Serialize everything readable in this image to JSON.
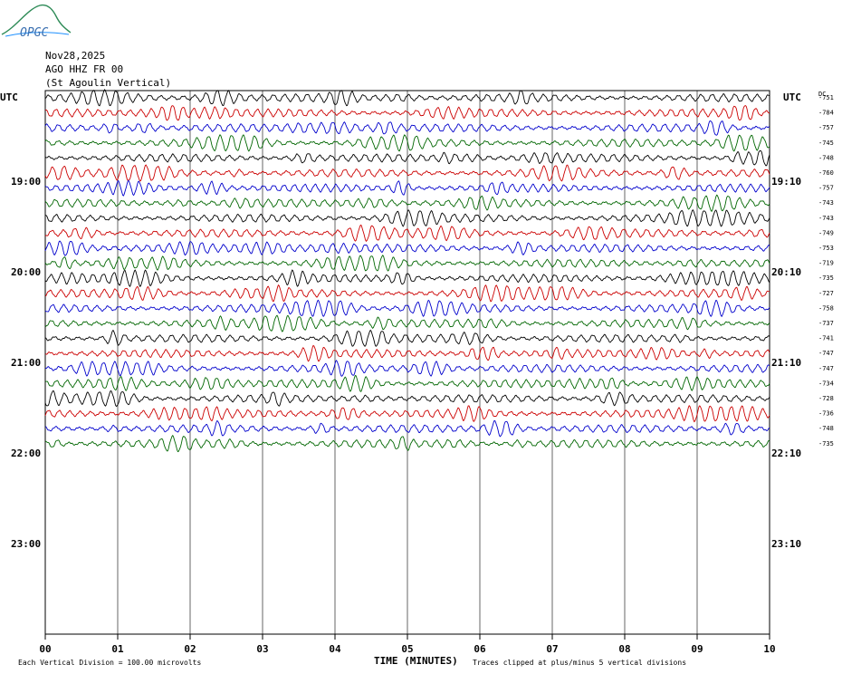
{
  "header": {
    "logo_text": "OPGC",
    "date": "Nov28,2025",
    "station": "AGO HHZ FR 00",
    "location": "(St Agoulin Vertical)"
  },
  "axes": {
    "left_utc": "UTC",
    "right_utc": "UTC",
    "dc_label": "DC",
    "x_title": "TIME (MINUTES)",
    "x_ticks": [
      "00",
      "01",
      "02",
      "03",
      "04",
      "05",
      "06",
      "07",
      "08",
      "09",
      "10"
    ],
    "left_hours": [
      "19:00",
      "20:00",
      "21:00",
      "22:00",
      "23:00"
    ],
    "right_hours": [
      "19:10",
      "20:10",
      "21:10",
      "22:10",
      "23:10"
    ]
  },
  "footer": {
    "left_note": "Each Vertical Division =  100.00 microvolts",
    "right_note": "Traces clipped at plus/minus 5 vertical divisions"
  },
  "chart_data": {
    "type": "line",
    "x_range_minutes": [
      0,
      10
    ],
    "trace_colors": [
      "#000000",
      "#cc0000",
      "#0000cc",
      "#006600"
    ],
    "dc_offsets": [
      -751,
      -784,
      -757,
      -745,
      -748,
      -760,
      -757,
      -743,
      -743,
      -749,
      -753,
      -719,
      -735,
      -727,
      -758,
      -737,
      -741,
      -747,
      -747,
      -734,
      -728,
      -736,
      -748,
      -735
    ],
    "traces_plotted": 24,
    "grid": true
  }
}
